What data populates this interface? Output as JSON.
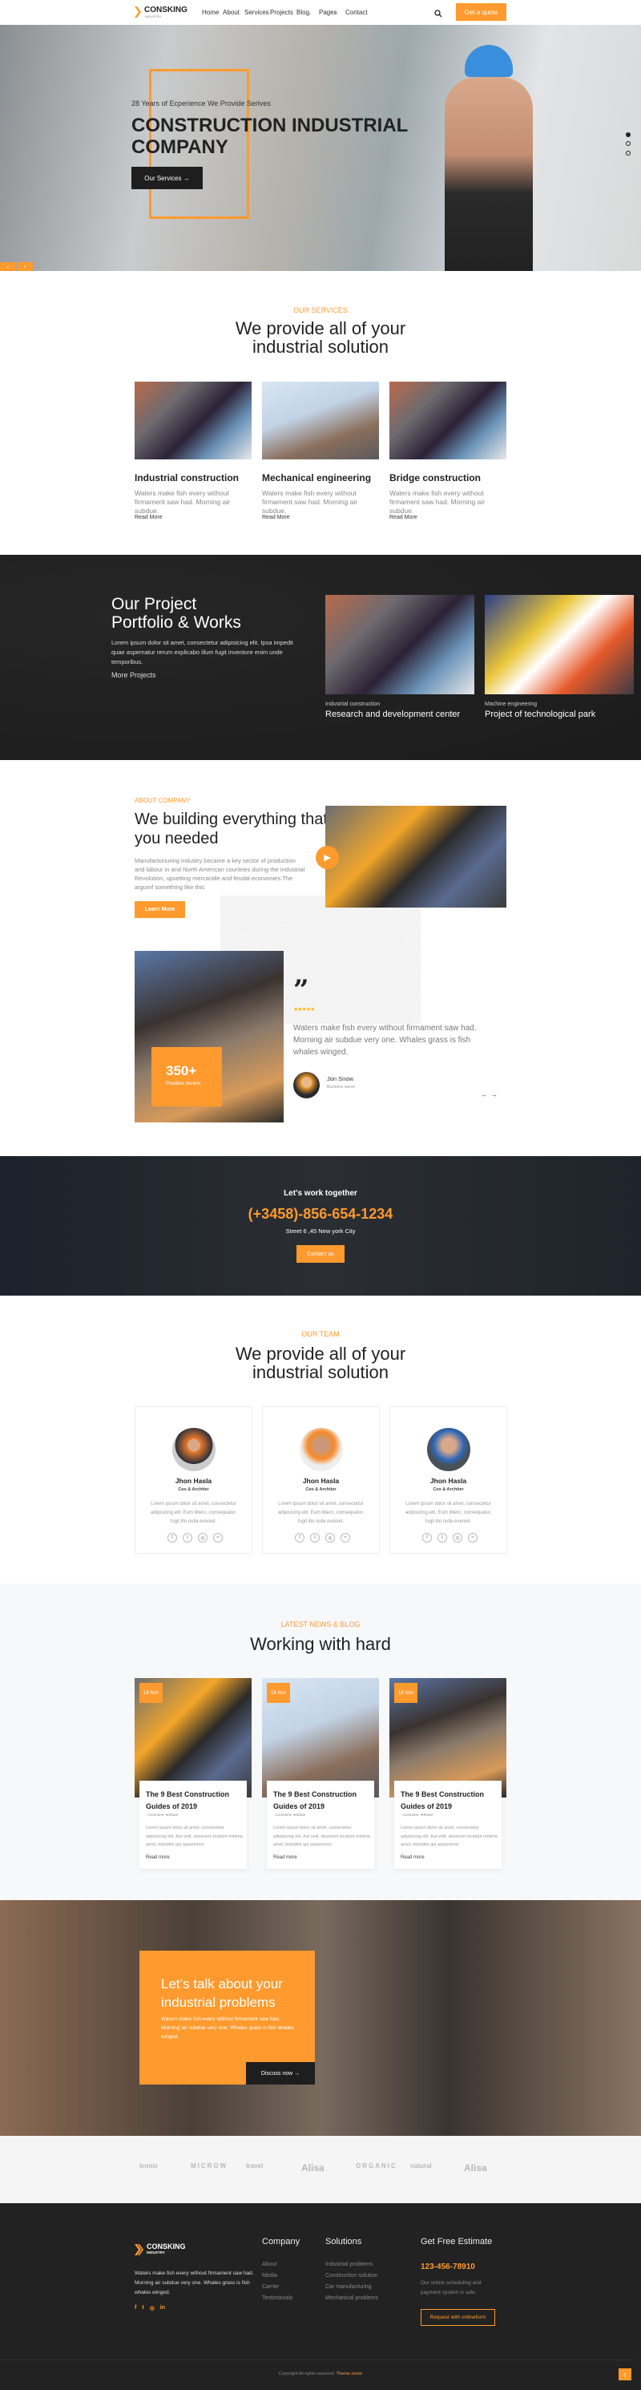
{
  "brand": {
    "name": "CONSKING",
    "tagline": "INDUSTRY",
    "accent": "#ff9a2e",
    "dark": "#1e1e1e"
  },
  "nav": {
    "items": [
      "Home",
      "About",
      "Services",
      "Projects",
      "Blog",
      "Pages",
      "Contact"
    ],
    "quote_button": "Get a quote",
    "search_icon": "search-icon"
  },
  "hero": {
    "subtitle": "28 Years of Ecperience We Provide Serives",
    "title_line1": "CONSTRUCTION INDUSTRIAL",
    "title_line2": "COMPANY",
    "button": "Our Services",
    "slide_count": 3,
    "active_slide": 1
  },
  "services": {
    "label": "OUR SERVICES",
    "title_line1": "We provide all of your",
    "title_line2": "industrial solution",
    "items": [
      {
        "title": "Industrial construction",
        "desc": "Waters make fish every without firmament saw had. Morning air subdue.",
        "link": "Read More"
      },
      {
        "title": "Mechanical engineering",
        "desc": "Waters make fish every without firmament saw had. Morning air subdue.",
        "link": "Read More"
      },
      {
        "title": "Bridge construction",
        "desc": "Waters make fish every without firmament saw had. Morning air subdue.",
        "link": "Read More"
      }
    ]
  },
  "projects": {
    "title_line1": "Our Project",
    "title_line2": "Portfolio & Works",
    "desc": "Lorem ipsum dolor sit amet, consectetur adipisicing elit. Ipsa impedit quae aspernatur rerum explicabo illum fugit inventore enim unde temporibus.",
    "link": "More Projects",
    "items": [
      {
        "category": "Industrial construction",
        "title": "Research and development center"
      },
      {
        "category": "Machine engineering",
        "title": "Project of technological park"
      }
    ]
  },
  "about": {
    "label": "ABOUT COMPANY",
    "title_line1": "We building everything that",
    "title_line2": "you needed",
    "desc": "Manufactoriuring industry became a key sector of production and labour in and North American countries during the Industrial Revolution, upsetting mercantile and feudal economies.The argumf something like this",
    "button": "Learn More"
  },
  "testimonial": {
    "count": "350+",
    "count_label": "Positive review",
    "rating": 5,
    "quote": "Waters make fish every without firmament saw had. Morning air subdue very one. Whales grass is fish whales winged.",
    "name": "Jon Snow",
    "role": "Business owner"
  },
  "cta": {
    "title": "Let's work together",
    "phone": "(+3458)-856-654-1234",
    "address": "Street 6 ,45 New york City",
    "button": "Contact us"
  },
  "team": {
    "label": "OUR TEAM",
    "title_line1": "We provide all of your",
    "title_line2": "industrial solution",
    "members": [
      {
        "name": "Jhon Hasla",
        "role": "Ceo & Architer",
        "desc": "Lorem ipsum dolor sit amet, consectetur adipisicing elit. Eum libero, consequatur, fugit illo nulla eveniet."
      },
      {
        "name": "Jhon Hasla",
        "role": "Ceo & Architer",
        "desc": "Lorem ipsum dolor sit amet, consectetur adipisicing elit. Eum libero, consequatur, fugit illo nulla eveniet."
      },
      {
        "name": "Jhon Hasla",
        "role": "Ceo & Architer",
        "desc": "Lorem ipsum dolor sit amet, consectetur adipisicing elit. Eum libero, consequatur, fugit illo nulla eveniet."
      }
    ]
  },
  "blog": {
    "label": "LATEST NEWS & BLOG",
    "title": "Working with hard",
    "posts": [
      {
        "date": "18 Nov",
        "title": "The 9 Best Construction Guides of 2019",
        "comment": "Comment",
        "share": "Share",
        "desc": "Lorem ipsum dolor sit amet, consectetur adipisicing elit. Aut velit, deserunt incidunt minima amet, blanditis qui asperiores!",
        "link": "Read more"
      },
      {
        "date": "18 Nov",
        "title": "The 9 Best Construction Guides of 2019",
        "comment": "Comment",
        "share": "Share",
        "desc": "Lorem ipsum dolor sit amet, consectetur adipisicing elit. Aut velit, deserunt incidunt minima amet, blanditis qui asperiores!",
        "link": "Read more"
      },
      {
        "date": "18 Nov",
        "title": "The 9 Best Construction Guides of 2019",
        "comment": "Comment",
        "share": "Share",
        "desc": "Lorem ipsum dolor sit amet, consectetur adipisicing elit. Aut velit, deserunt incidunt minima amet, blanditis qui asperiores!",
        "link": "Read more"
      }
    ]
  },
  "talk": {
    "title_line1": "Let’s talk about your",
    "title_line2": "industrial problems",
    "desc": "Waters make fish every without firmament saw had. Morning air subdue very one. Whales grass is fish whales winged.",
    "button": "Discuss now"
  },
  "partners": [
    "Iconic",
    "MICROW",
    "travel",
    "Alisa",
    "ORGANIC",
    "natural",
    "Alisa"
  ],
  "footer": {
    "desc": "Waters make fish every without firmament saw had. Morning air subdue very one. Whales grass is fish whales winged.",
    "company_title": "Company",
    "company_links": [
      "About",
      "Media",
      "Carrier",
      "Testimonials"
    ],
    "solutions_title": "Solutions",
    "solutions_links": [
      "Industrial problems",
      "Construction solution",
      "Car manufacturing",
      "Mechanical problems"
    ],
    "estimate_title": "Get Free Estimate",
    "phone": "123-456-78910",
    "estimate_desc": "Our online scheduling and payment system is safe.",
    "estimate_button": "Request with onlineform",
    "copyright": "Copyright All rights reserved",
    "credit": "Theme-zome"
  }
}
